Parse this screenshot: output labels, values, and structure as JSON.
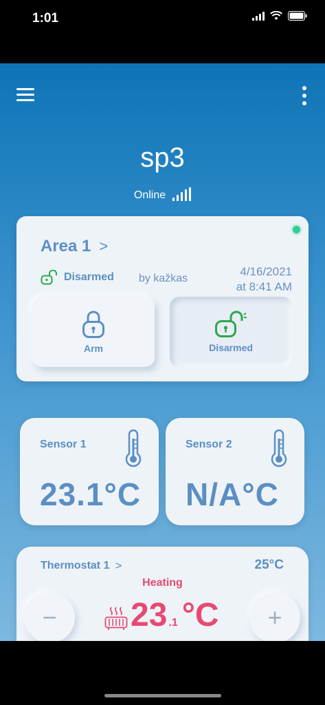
{
  "status_bar": {
    "time": "1:01"
  },
  "header": {
    "device_name": "sp3",
    "connection_status": "Online"
  },
  "area": {
    "title": "Area 1",
    "state": "Disarmed",
    "by": "by kažkas",
    "date": "4/16/2021",
    "time": "at 8:41 AM",
    "arm_label": "Arm",
    "disarm_label": "Disarmed"
  },
  "sensors": [
    {
      "name": "Sensor 1",
      "value": "23.1°C"
    },
    {
      "name": "Sensor 2",
      "value": "N/A°C"
    }
  ],
  "thermostat": {
    "title": "Thermostat 1",
    "setpoint": "25°C",
    "mode": "Heating",
    "temp_whole": "23",
    "temp_decimal": ".1",
    "temp_unit": "°C",
    "minus": "−",
    "plus": "+"
  },
  "colors": {
    "accent": "#5b8fc3",
    "heating": "#e64a72",
    "disarmed": "#2aa84a",
    "online_dot": "#2fcf93"
  },
  "icons": [
    "wifi-icon",
    "battery-icon",
    "menu-icon",
    "more-vertical-icon",
    "signal-icon",
    "unlock-icon",
    "lock-icon",
    "thermometer-icon",
    "heater-icon"
  ]
}
